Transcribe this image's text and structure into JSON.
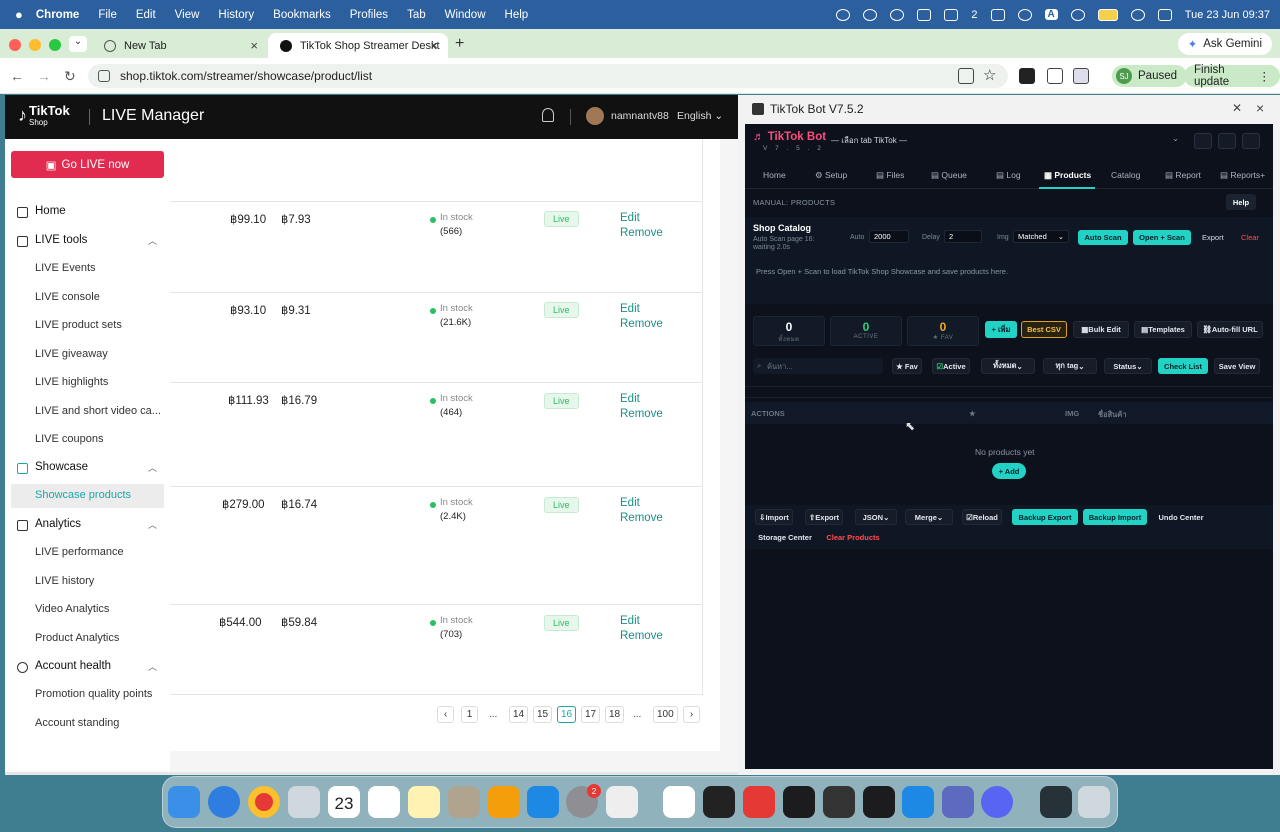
{
  "menubar": {
    "apple": "",
    "app": "Chrome",
    "items": [
      "File",
      "Edit",
      "View",
      "History",
      "Bookmarks",
      "Profiles",
      "Tab",
      "Window",
      "Help"
    ],
    "battery_count": "2",
    "input_letter": "A",
    "datetime": "Tue 23 Jun  09:37"
  },
  "browser": {
    "tabs": [
      {
        "title": "New Tab",
        "close": "×"
      },
      {
        "title": "TikTok Shop Streamer Deskto",
        "close": "×"
      }
    ],
    "new_tab": "+",
    "gemini": "Ask Gemini",
    "url": "shop.tiktok.com/streamer/showcase/product/list",
    "profile_initials": "SJ",
    "profile_status": "Paused",
    "finish_update": "Finish update"
  },
  "tiktok": {
    "logo_brand": "TikTok",
    "logo_sub": "Shop",
    "title": "LIVE Manager",
    "username": "namnantv88",
    "language": "English",
    "go_live": "Go LIVE now",
    "sidebar": {
      "home": "Home",
      "live_tools": "LIVE tools",
      "live_items": [
        "LIVE Events",
        "LIVE console",
        "LIVE product sets",
        "LIVE giveaway",
        "LIVE highlights",
        "LIVE and short video ca...",
        "LIVE coupons"
      ],
      "showcase": "Showcase",
      "showcase_products": "Showcase products",
      "analytics": "Analytics",
      "analytics_items": [
        "LIVE performance",
        "LIVE history",
        "Video Analytics",
        "Product Analytics"
      ],
      "account_health": "Account health",
      "account_items": [
        "Promotion quality points",
        "Account standing"
      ]
    },
    "rows": [
      {
        "price": "฿99.10",
        "commission": "฿7.93",
        "stock_label": "In stock",
        "stock_count": "(566)",
        "status": "Live",
        "edit": "Edit",
        "remove": "Remove"
      },
      {
        "price": "฿93.10",
        "commission": "฿9.31",
        "stock_label": "In stock",
        "stock_count": "(21.6K)",
        "status": "Live",
        "edit": "Edit",
        "remove": "Remove"
      },
      {
        "price": "฿111.93",
        "commission": "฿16.79",
        "stock_label": "In stock",
        "stock_count": "(464)",
        "status": "Live",
        "edit": "Edit",
        "remove": "Remove"
      },
      {
        "price": "฿279.00",
        "commission": "฿16.74",
        "stock_label": "In stock",
        "stock_count": "(2.4K)",
        "status": "Live",
        "edit": "Edit",
        "remove": "Remove"
      },
      {
        "price": "฿544.00",
        "commission": "฿59.84",
        "stock_label": "In stock",
        "stock_count": "(703)",
        "status": "Live",
        "edit": "Edit",
        "remove": "Remove"
      }
    ],
    "pagination": {
      "prev": "‹",
      "pages": [
        "1",
        "...",
        "14",
        "15",
        "16",
        "17",
        "18",
        "...",
        "100"
      ],
      "current": "16",
      "next": "›"
    }
  },
  "bot": {
    "window_title": "TikTok Bot V7.5.2",
    "logo": "♬ TikTok Bot",
    "version": "V 7 . 5 . 2",
    "tab_select": "— เลือก tab TikTok —",
    "tabs": [
      "Home",
      "⚙ Setup",
      "▤ Files",
      "▤ Queue",
      "▤ Log",
      "▦ Products",
      "Catalog",
      "▤ Report",
      "▤ Reports+"
    ],
    "section_label": "MANUAL: PRODUCTS",
    "help": "Help",
    "catalog": {
      "title": "Shop Catalog",
      "subtitle": "Auto Scan page 16: waiting 2.0s",
      "auto_label": "Auto",
      "auto_value": "2000",
      "delay_label": "Delay",
      "delay_value": "2",
      "img_label": "Img",
      "img_value": "Matched",
      "auto_scan": "Auto Scan",
      "open_scan": "Open + Scan",
      "export": "Export",
      "clear": "Clear",
      "hint": "Press Open + Scan to load TikTok Shop Showcase and save products here."
    },
    "stats": [
      {
        "value": "0",
        "label": "ทั้งหมด"
      },
      {
        "value": "0",
        "label": "ACTIVE"
      },
      {
        "value": "0",
        "label": "★ FAV"
      }
    ],
    "actions": {
      "add": "+ เพิ่ม",
      "best_csv": "Best CSV",
      "bulk_edit": "Bulk Edit",
      "templates": "Templates",
      "autofill": "Auto-fill URL"
    },
    "filters": {
      "search_placeholder": "ค้นหา...",
      "fav": "★ Fav",
      "active": "Active",
      "all": "ทั้งหมด",
      "all_tags": "ทุก tag",
      "status": "Status",
      "check_list": "Check List",
      "save_view": "Save View"
    },
    "table_headers": {
      "actions": "ACTIONS",
      "star": "★",
      "img": "IMG",
      "name": "ชื่อสินค้า"
    },
    "empty_text": "No products yet",
    "add_button": "+ Add",
    "footer": {
      "import": "Import",
      "export": "Export",
      "format": "JSON",
      "mode": "Merge",
      "reload": "Reload",
      "backup_export": "Backup Export",
      "backup_import": "Backup Import",
      "undo_center": "Undo Center",
      "storage_center": "Storage Center",
      "clear_products": "Clear Products"
    }
  },
  "dock": {
    "calendar_day": "23",
    "settings_badge": "2",
    "apps": [
      "Finder",
      "Safari",
      "Chrome",
      "Launchpad",
      "Calendar",
      "Reminders",
      "Notes",
      "Contacts",
      "Pages",
      "App Store",
      "System Settings",
      "Photo Booth",
      "Windows App",
      "Dots",
      "Mi",
      "Activity Monitor",
      "Tool",
      "Terminal",
      "VS Code",
      "Preview",
      "Teams",
      "Downloads",
      "Trash"
    ]
  }
}
